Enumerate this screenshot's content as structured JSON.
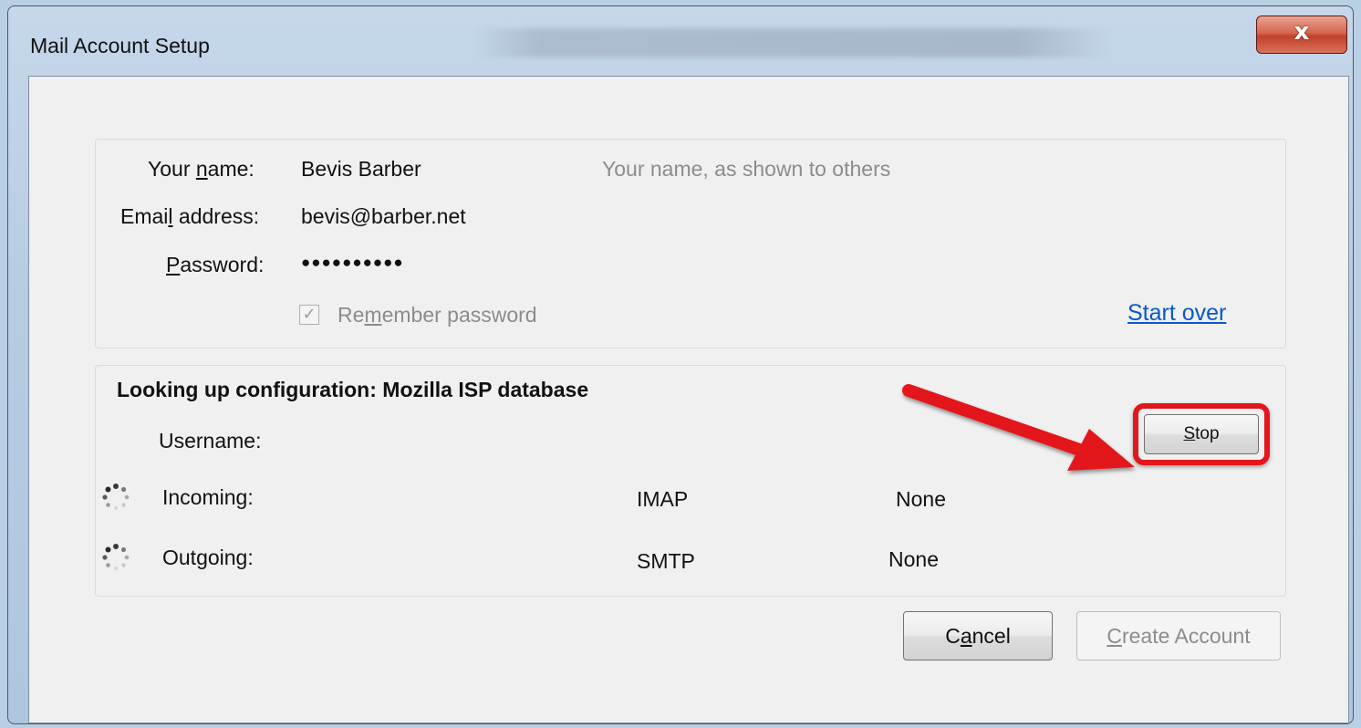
{
  "window": {
    "title": "Mail Account Setup",
    "close_label": "x"
  },
  "account": {
    "name_label_pre": "Your ",
    "name_label_key": "n",
    "name_label_post": "ame:",
    "name_value": "Bevis Barber",
    "name_hint": "Your name, as shown to others",
    "email_label_pre": "Emai",
    "email_label_key": "l",
    "email_label_post": " address:",
    "email_value": "bevis@barber.net",
    "password_label_key": "P",
    "password_label_post": "assword:",
    "password_value": "●●●●●●●●●●",
    "remember_pre": "Re",
    "remember_key": "m",
    "remember_post": "ember password",
    "remember_checked": true,
    "start_over": "Start over"
  },
  "config": {
    "status": "Looking up configuration: Mozilla ISP database",
    "username_label": "Username:",
    "stop_key": "S",
    "stop_post": "top",
    "incoming_label": "Incoming:",
    "incoming_protocol": "IMAP",
    "incoming_security": "None",
    "outgoing_label": "Outgoing:",
    "outgoing_protocol": "SMTP",
    "outgoing_security": "None"
  },
  "footer": {
    "cancel_pre": "C",
    "cancel_key": "a",
    "cancel_post": "ncel",
    "create_key": "C",
    "create_post": "reate Account"
  },
  "colors": {
    "highlight": "#e3161c",
    "link": "#0a58c9",
    "hint_text": "#8c8c8c"
  }
}
